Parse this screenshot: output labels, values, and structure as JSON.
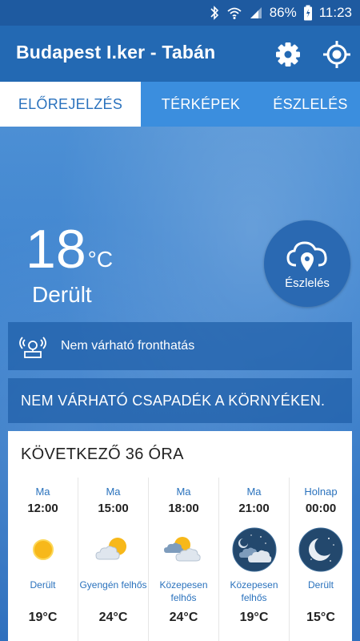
{
  "status": {
    "battery": "86%",
    "time": "11:23"
  },
  "appbar": {
    "title": "Budapest I.ker - Tabán"
  },
  "tabs": [
    {
      "label": "ELŐREJELZÉS",
      "active": true
    },
    {
      "label": "TÉRKÉPEK",
      "active": false
    },
    {
      "label": "ÉSZLELÉS",
      "active": false
    }
  ],
  "current": {
    "temp": "18",
    "unit": "°C",
    "condition": "Derült"
  },
  "observe_button": {
    "label": "Észlelés"
  },
  "front": {
    "text": "Nem várható fronthatás"
  },
  "precip": {
    "text": "NEM VÁRHATÓ CSAPADÉK A KÖRNYÉKEN."
  },
  "forecast": {
    "title": "KÖVETKEZŐ 36 ÓRA",
    "hours": [
      {
        "day": "Ma",
        "time": "12:00",
        "desc": "Derült",
        "temp": "19°C",
        "icon": "sun-icon"
      },
      {
        "day": "Ma",
        "time": "15:00",
        "desc": "Gyengén felhős",
        "temp": "24°C",
        "icon": "sun-cloud-icon"
      },
      {
        "day": "Ma",
        "time": "18:00",
        "desc": "Közepesen felhős",
        "temp": "24°C",
        "icon": "sun-clouds-icon"
      },
      {
        "day": "Ma",
        "time": "21:00",
        "desc": "Közepesen felhős",
        "temp": "19°C",
        "icon": "moon-clouds-icon"
      },
      {
        "day": "Holnap",
        "time": "00:00",
        "desc": "Derült",
        "temp": "15°C",
        "icon": "moon-icon"
      }
    ]
  },
  "colors": {
    "accent": "#2a72bd",
    "appbar": "#2369b3",
    "tabbar": "#3b8ede"
  }
}
